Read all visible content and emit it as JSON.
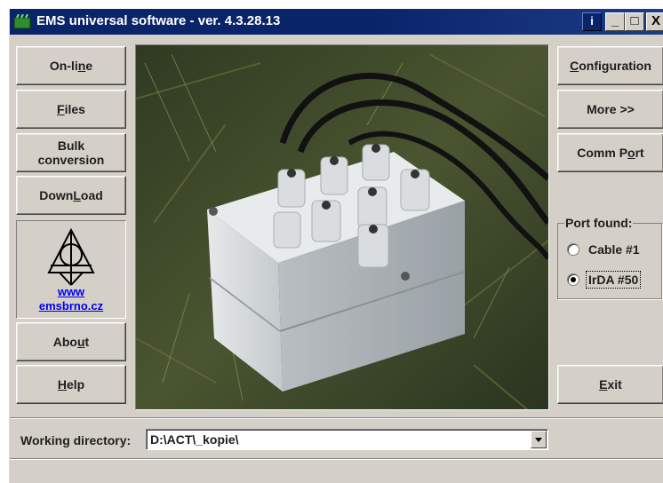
{
  "window": {
    "title": "EMS universal software - ver. 4.3.28.13",
    "info_label": "i",
    "min_label": "_",
    "max_label": "□",
    "close_label": "X"
  },
  "left_buttons": {
    "online": {
      "pre": "On-li",
      "u": "n",
      "post": "e"
    },
    "files": {
      "pre": "",
      "u": "F",
      "post": "iles"
    },
    "bulk": {
      "line1": "Bulk",
      "line2": "conversion"
    },
    "download": {
      "pre": "Down",
      "u": "L",
      "post": "oad"
    },
    "about": {
      "pre": "Abo",
      "u": "u",
      "post": "t"
    },
    "help": {
      "pre": "",
      "u": "H",
      "post": "elp"
    }
  },
  "logo": {
    "link_line1": "www",
    "link_line2": "emsbrno.cz"
  },
  "right_buttons": {
    "configuration": {
      "pre": "",
      "u": "C",
      "post": "onfiguration"
    },
    "more": "More >>",
    "comm_port": {
      "pre": "Comm P",
      "u": "o",
      "post": "rt"
    },
    "exit": {
      "pre": "",
      "u": "E",
      "post": "xit"
    }
  },
  "port_group": {
    "title": "Port found:",
    "options": [
      {
        "label": "Cable #1",
        "selected": false
      },
      {
        "label": "IrDA #50",
        "selected": true
      }
    ]
  },
  "working_directory": {
    "label": "Working directory:",
    "value": "D:\\ACT\\_kopie\\"
  },
  "colors": {
    "titlebar": "#0a246a",
    "face": "#d4d0c8",
    "link": "#0000ee"
  }
}
